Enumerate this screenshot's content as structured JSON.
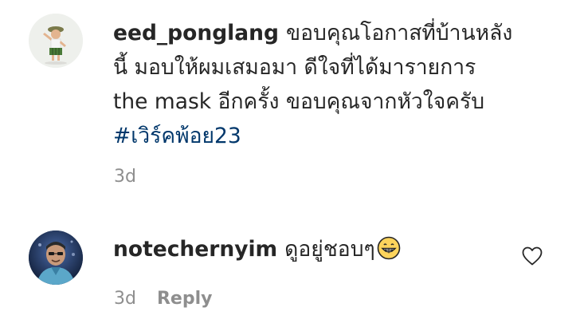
{
  "comments": [
    {
      "username": "eed_ponglang",
      "line1": "ขอบคุณโอกาสที่บ้านหลัง",
      "line2": "นี้ มอบให้ผมเสมอมา ดีใจที่ได้มารายการ",
      "line3": "the mask อีกครั้ง ขอบคุณจากหัวใจครับ",
      "hashtag": "#เวิร์คพ้อย23",
      "time": "3d"
    },
    {
      "username": "notechernyim",
      "text": "ดูอยู่ชอบๆ",
      "emoji": "grinning-face-emoji",
      "time": "3d",
      "reply_label": "Reply"
    }
  ],
  "icons": {
    "like": "heart-outline-icon"
  },
  "colors": {
    "text": "#262626",
    "muted": "#8e8e8e",
    "hashtag": "#00376b"
  }
}
